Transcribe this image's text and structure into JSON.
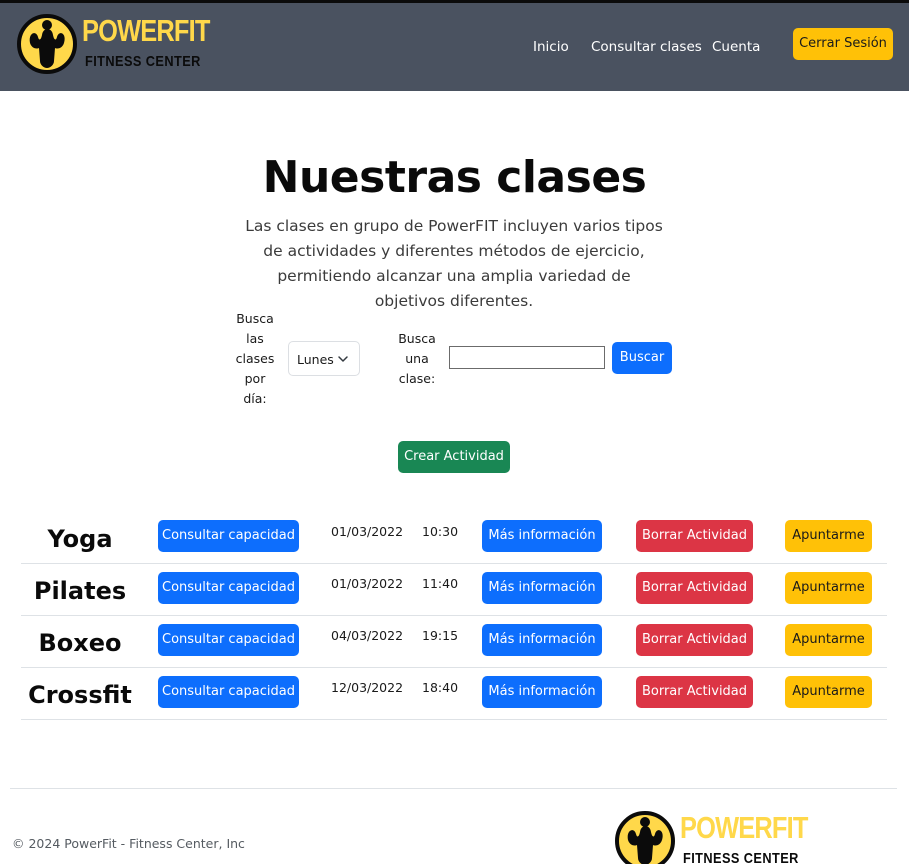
{
  "brand": {
    "name": "POWERFIT",
    "tagline": "FITNESS CENTER",
    "accent": "#ffd84a"
  },
  "nav": {
    "links": [
      "Inicio",
      "Consultar clases",
      "Cuenta"
    ],
    "logout_label": "Cerrar Sesión"
  },
  "hero": {
    "title": "Nuestras clases",
    "subtitle": "Las clases en grupo de PowerFIT incluyen varios tipos de actividades y diferentes métodos de ejercicio, permitiendo alcanzar una amplia variedad de objetivos diferentes."
  },
  "search": {
    "day_label": "Busca las clases por día:",
    "day_selected": "Lunes",
    "class_label": "Busca una clase:",
    "class_value": "",
    "search_button": "Buscar",
    "create_button": "Crear Actividad"
  },
  "row_buttons": {
    "capacity": "Consultar capacidad",
    "info": "Más información",
    "delete": "Borrar Actividad",
    "join": "Apuntarme"
  },
  "classes": [
    {
      "name": "Yoga",
      "date": "01/03/2022",
      "time": "10:30"
    },
    {
      "name": "Pilates",
      "date": "01/03/2022",
      "time": "11:40"
    },
    {
      "name": "Boxeo",
      "date": "04/03/2022",
      "time": "19:15"
    },
    {
      "name": "Crossfit",
      "date": "12/03/2022",
      "time": "18:40"
    }
  ],
  "footer": {
    "copyright": "© 2024 PowerFit - Fitness Center, Inc"
  },
  "colors": {
    "navbar": "#4a5260",
    "primary": "#0d6efd",
    "danger": "#dc3545",
    "warning": "#ffc107",
    "success": "#198754"
  }
}
